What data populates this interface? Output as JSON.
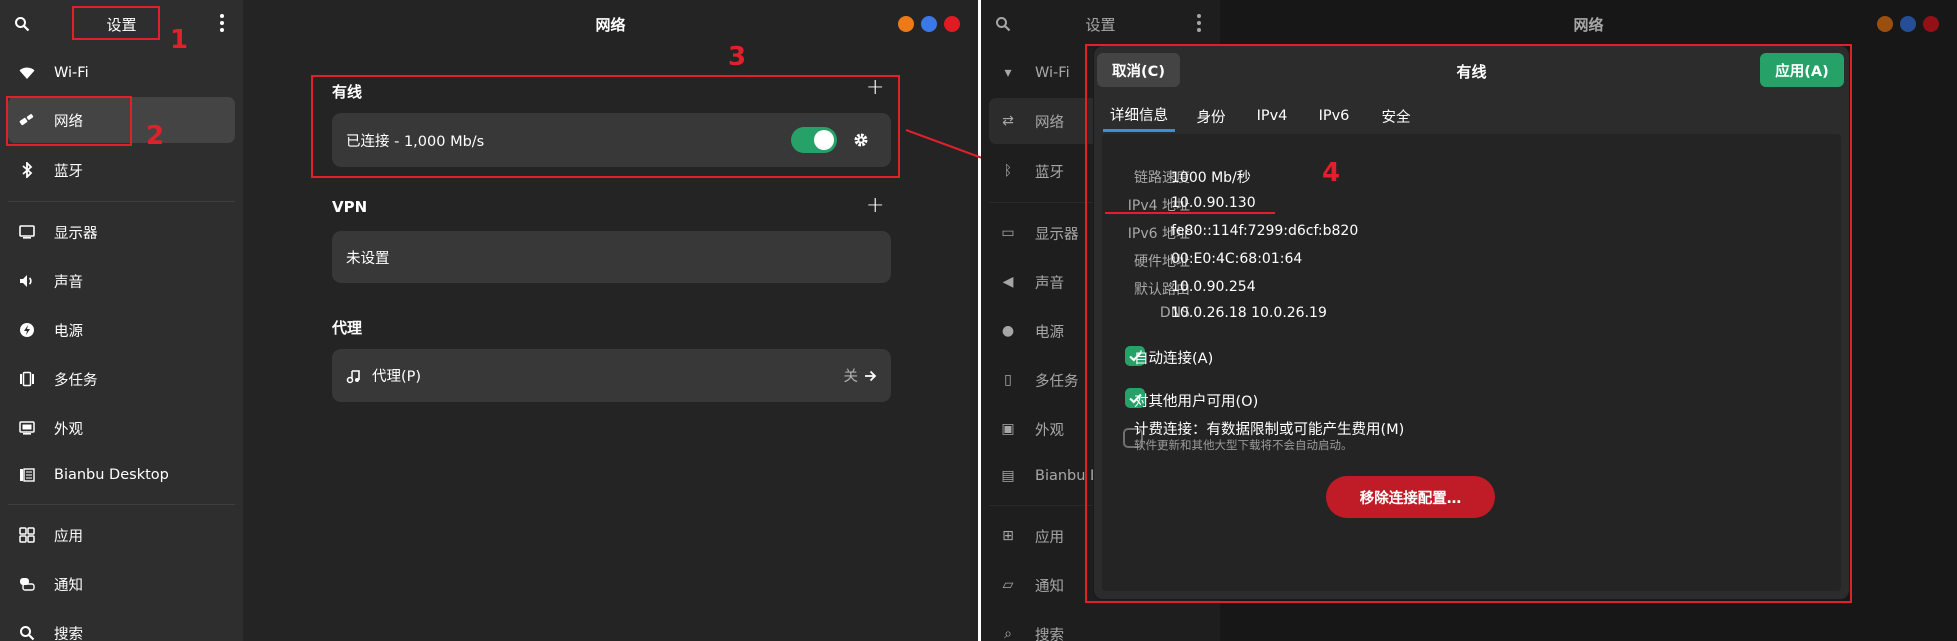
{
  "left_window": {
    "sidebar": {
      "title": "设置",
      "items": [
        {
          "label": "Wi-Fi",
          "icon": "wifi-icon"
        },
        {
          "label": "网络",
          "icon": "network-icon",
          "selected": true
        },
        {
          "label": "蓝牙",
          "icon": "bluetooth-icon"
        },
        {
          "label": "显示器",
          "icon": "display-icon"
        },
        {
          "label": "声音",
          "icon": "sound-icon"
        },
        {
          "label": "电源",
          "icon": "power-icon"
        },
        {
          "label": "多任务",
          "icon": "multitasking-icon"
        },
        {
          "label": "外观",
          "icon": "appearance-icon"
        },
        {
          "label": "Bianbu Desktop",
          "icon": "desktop-icon"
        },
        {
          "label": "应用",
          "icon": "apps-icon"
        },
        {
          "label": "通知",
          "icon": "notifications-icon"
        },
        {
          "label": "搜索",
          "icon": "search-icon"
        }
      ]
    },
    "title": "网络",
    "wired": {
      "title": "有线",
      "status": "已连接 - 1,000 Mb/s",
      "enabled": true
    },
    "vpn": {
      "title": "VPN",
      "status": "未设置"
    },
    "proxy": {
      "title": "代理",
      "label": "代理(P)",
      "state": "关"
    }
  },
  "right_window": {
    "sidebar": {
      "title": "设置",
      "items": [
        {
          "label": "Wi-Fi"
        },
        {
          "label": "网络",
          "selected": true
        },
        {
          "label": "蓝牙"
        },
        {
          "label": "显示器"
        },
        {
          "label": "声音"
        },
        {
          "label": "电源"
        },
        {
          "label": "多任务"
        },
        {
          "label": "外观"
        },
        {
          "label": "Bianbu De"
        },
        {
          "label": "应用"
        },
        {
          "label": "通知"
        },
        {
          "label": "搜索"
        }
      ]
    },
    "title": "网络",
    "dialog": {
      "title": "有线",
      "cancel_label": "取消(C)",
      "apply_label": "应用(A)",
      "tabs": [
        "详细信息",
        "身份",
        "IPv4",
        "IPv6",
        "安全"
      ],
      "details": [
        {
          "label": "链路速度",
          "value": "1000 Mb/秒"
        },
        {
          "label": "IPv4 地址",
          "value": "10.0.90.130"
        },
        {
          "label": "IPv6 地址",
          "value": "fe80::114f:7299:d6cf:b820"
        },
        {
          "label": "硬件地址",
          "value": "00:E0:4C:68:01:64"
        },
        {
          "label": "默认路由",
          "value": "10.0.90.254"
        },
        {
          "label": "DNS",
          "value": "10.0.26.18 10.0.26.19"
        }
      ],
      "auto_connect": {
        "label": "自动连接(A)",
        "checked": true
      },
      "all_users": {
        "label": "对其他用户可用(O)",
        "checked": true
      },
      "metered": {
        "label": "计费连接：有数据限制或可能产生费用(M)",
        "sub": "软件更新和其他大型下载将不会自动启动。",
        "checked": false
      },
      "remove_label": "移除连接配置…"
    }
  },
  "annotations": [
    "1",
    "2",
    "3",
    "4"
  ],
  "colors": {
    "annotation": "#e0202a",
    "accent_green": "#26a269",
    "destructive": "#c01c28",
    "window_bg": "#242424",
    "sidebar_bg": "#2e2e2e",
    "card_bg": "#383838"
  }
}
